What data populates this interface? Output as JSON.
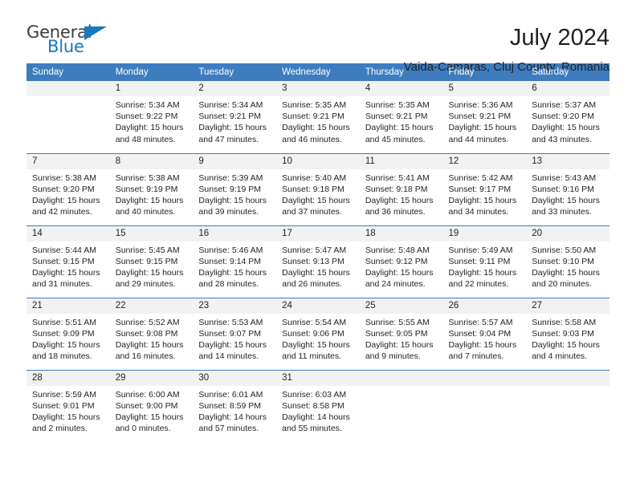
{
  "logo": {
    "word_one": "General",
    "word_two": "Blue",
    "flag_icon": "triangle-flag-icon"
  },
  "header": {
    "month_title": "July 2024",
    "location": "Vaida-Camaras, Cluj County, Romania"
  },
  "calendar": {
    "weekday_headers": [
      "Sunday",
      "Monday",
      "Tuesday",
      "Wednesday",
      "Thursday",
      "Friday",
      "Saturday"
    ],
    "accent_color": "#3d7dbf",
    "daynum_band_color": "#f2f2f2",
    "weeks": [
      [
        {
          "day": "",
          "empty": true,
          "sunrise": "",
          "sunset": "",
          "daylight_line1": "",
          "daylight_line2": ""
        },
        {
          "day": "1",
          "sunrise": "Sunrise: 5:34 AM",
          "sunset": "Sunset: 9:22 PM",
          "daylight_line1": "Daylight: 15 hours",
          "daylight_line2": "and 48 minutes."
        },
        {
          "day": "2",
          "sunrise": "Sunrise: 5:34 AM",
          "sunset": "Sunset: 9:21 PM",
          "daylight_line1": "Daylight: 15 hours",
          "daylight_line2": "and 47 minutes."
        },
        {
          "day": "3",
          "sunrise": "Sunrise: 5:35 AM",
          "sunset": "Sunset: 9:21 PM",
          "daylight_line1": "Daylight: 15 hours",
          "daylight_line2": "and 46 minutes."
        },
        {
          "day": "4",
          "sunrise": "Sunrise: 5:35 AM",
          "sunset": "Sunset: 9:21 PM",
          "daylight_line1": "Daylight: 15 hours",
          "daylight_line2": "and 45 minutes."
        },
        {
          "day": "5",
          "sunrise": "Sunrise: 5:36 AM",
          "sunset": "Sunset: 9:21 PM",
          "daylight_line1": "Daylight: 15 hours",
          "daylight_line2": "and 44 minutes."
        },
        {
          "day": "6",
          "sunrise": "Sunrise: 5:37 AM",
          "sunset": "Sunset: 9:20 PM",
          "daylight_line1": "Daylight: 15 hours",
          "daylight_line2": "and 43 minutes."
        }
      ],
      [
        {
          "day": "7",
          "sunrise": "Sunrise: 5:38 AM",
          "sunset": "Sunset: 9:20 PM",
          "daylight_line1": "Daylight: 15 hours",
          "daylight_line2": "and 42 minutes."
        },
        {
          "day": "8",
          "sunrise": "Sunrise: 5:38 AM",
          "sunset": "Sunset: 9:19 PM",
          "daylight_line1": "Daylight: 15 hours",
          "daylight_line2": "and 40 minutes."
        },
        {
          "day": "9",
          "sunrise": "Sunrise: 5:39 AM",
          "sunset": "Sunset: 9:19 PM",
          "daylight_line1": "Daylight: 15 hours",
          "daylight_line2": "and 39 minutes."
        },
        {
          "day": "10",
          "sunrise": "Sunrise: 5:40 AM",
          "sunset": "Sunset: 9:18 PM",
          "daylight_line1": "Daylight: 15 hours",
          "daylight_line2": "and 37 minutes."
        },
        {
          "day": "11",
          "sunrise": "Sunrise: 5:41 AM",
          "sunset": "Sunset: 9:18 PM",
          "daylight_line1": "Daylight: 15 hours",
          "daylight_line2": "and 36 minutes."
        },
        {
          "day": "12",
          "sunrise": "Sunrise: 5:42 AM",
          "sunset": "Sunset: 9:17 PM",
          "daylight_line1": "Daylight: 15 hours",
          "daylight_line2": "and 34 minutes."
        },
        {
          "day": "13",
          "sunrise": "Sunrise: 5:43 AM",
          "sunset": "Sunset: 9:16 PM",
          "daylight_line1": "Daylight: 15 hours",
          "daylight_line2": "and 33 minutes."
        }
      ],
      [
        {
          "day": "14",
          "sunrise": "Sunrise: 5:44 AM",
          "sunset": "Sunset: 9:15 PM",
          "daylight_line1": "Daylight: 15 hours",
          "daylight_line2": "and 31 minutes."
        },
        {
          "day": "15",
          "sunrise": "Sunrise: 5:45 AM",
          "sunset": "Sunset: 9:15 PM",
          "daylight_line1": "Daylight: 15 hours",
          "daylight_line2": "and 29 minutes."
        },
        {
          "day": "16",
          "sunrise": "Sunrise: 5:46 AM",
          "sunset": "Sunset: 9:14 PM",
          "daylight_line1": "Daylight: 15 hours",
          "daylight_line2": "and 28 minutes."
        },
        {
          "day": "17",
          "sunrise": "Sunrise: 5:47 AM",
          "sunset": "Sunset: 9:13 PM",
          "daylight_line1": "Daylight: 15 hours",
          "daylight_line2": "and 26 minutes."
        },
        {
          "day": "18",
          "sunrise": "Sunrise: 5:48 AM",
          "sunset": "Sunset: 9:12 PM",
          "daylight_line1": "Daylight: 15 hours",
          "daylight_line2": "and 24 minutes."
        },
        {
          "day": "19",
          "sunrise": "Sunrise: 5:49 AM",
          "sunset": "Sunset: 9:11 PM",
          "daylight_line1": "Daylight: 15 hours",
          "daylight_line2": "and 22 minutes."
        },
        {
          "day": "20",
          "sunrise": "Sunrise: 5:50 AM",
          "sunset": "Sunset: 9:10 PM",
          "daylight_line1": "Daylight: 15 hours",
          "daylight_line2": "and 20 minutes."
        }
      ],
      [
        {
          "day": "21",
          "sunrise": "Sunrise: 5:51 AM",
          "sunset": "Sunset: 9:09 PM",
          "daylight_line1": "Daylight: 15 hours",
          "daylight_line2": "and 18 minutes."
        },
        {
          "day": "22",
          "sunrise": "Sunrise: 5:52 AM",
          "sunset": "Sunset: 9:08 PM",
          "daylight_line1": "Daylight: 15 hours",
          "daylight_line2": "and 16 minutes."
        },
        {
          "day": "23",
          "sunrise": "Sunrise: 5:53 AM",
          "sunset": "Sunset: 9:07 PM",
          "daylight_line1": "Daylight: 15 hours",
          "daylight_line2": "and 14 minutes."
        },
        {
          "day": "24",
          "sunrise": "Sunrise: 5:54 AM",
          "sunset": "Sunset: 9:06 PM",
          "daylight_line1": "Daylight: 15 hours",
          "daylight_line2": "and 11 minutes."
        },
        {
          "day": "25",
          "sunrise": "Sunrise: 5:55 AM",
          "sunset": "Sunset: 9:05 PM",
          "daylight_line1": "Daylight: 15 hours",
          "daylight_line2": "and 9 minutes."
        },
        {
          "day": "26",
          "sunrise": "Sunrise: 5:57 AM",
          "sunset": "Sunset: 9:04 PM",
          "daylight_line1": "Daylight: 15 hours",
          "daylight_line2": "and 7 minutes."
        },
        {
          "day": "27",
          "sunrise": "Sunrise: 5:58 AM",
          "sunset": "Sunset: 9:03 PM",
          "daylight_line1": "Daylight: 15 hours",
          "daylight_line2": "and 4 minutes."
        }
      ],
      [
        {
          "day": "28",
          "sunrise": "Sunrise: 5:59 AM",
          "sunset": "Sunset: 9:01 PM",
          "daylight_line1": "Daylight: 15 hours",
          "daylight_line2": "and 2 minutes."
        },
        {
          "day": "29",
          "sunrise": "Sunrise: 6:00 AM",
          "sunset": "Sunset: 9:00 PM",
          "daylight_line1": "Daylight: 15 hours",
          "daylight_line2": "and 0 minutes."
        },
        {
          "day": "30",
          "sunrise": "Sunrise: 6:01 AM",
          "sunset": "Sunset: 8:59 PM",
          "daylight_line1": "Daylight: 14 hours",
          "daylight_line2": "and 57 minutes."
        },
        {
          "day": "31",
          "sunrise": "Sunrise: 6:03 AM",
          "sunset": "Sunset: 8:58 PM",
          "daylight_line1": "Daylight: 14 hours",
          "daylight_line2": "and 55 minutes."
        },
        {
          "day": "",
          "empty": true,
          "sunrise": "",
          "sunset": "",
          "daylight_line1": "",
          "daylight_line2": ""
        },
        {
          "day": "",
          "empty": true,
          "sunrise": "",
          "sunset": "",
          "daylight_line1": "",
          "daylight_line2": ""
        },
        {
          "day": "",
          "empty": true,
          "sunrise": "",
          "sunset": "",
          "daylight_line1": "",
          "daylight_line2": ""
        }
      ]
    ]
  }
}
